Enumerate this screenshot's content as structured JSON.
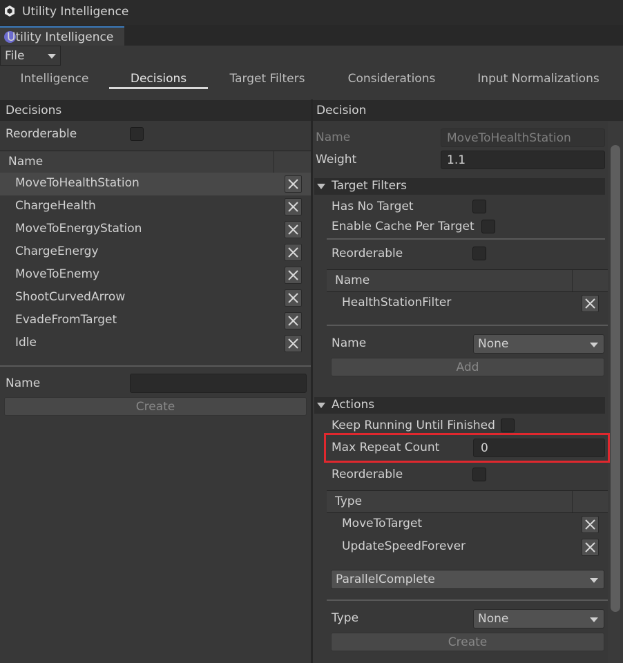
{
  "window": {
    "title": "Utility Intelligence",
    "tab_label": "Utility Intelligence"
  },
  "menu": {
    "file_label": "File"
  },
  "tabs": [
    {
      "label": "Intelligence"
    },
    {
      "label": "Decisions"
    },
    {
      "label": "Target Filters"
    },
    {
      "label": "Considerations"
    },
    {
      "label": "Input Normalizations"
    }
  ],
  "active_tab": "Decisions",
  "left_panel": {
    "header": "Decisions",
    "reorderable_label": "Reorderable",
    "column_name": "Name",
    "items": [
      {
        "label": "MoveToHealthStation"
      },
      {
        "label": "ChargeHealth"
      },
      {
        "label": "MoveToEnergyStation"
      },
      {
        "label": "ChargeEnergy"
      },
      {
        "label": "MoveToEnemy"
      },
      {
        "label": "ShootCurvedArrow"
      },
      {
        "label": "EvadeFromTarget"
      },
      {
        "label": "Idle"
      }
    ],
    "name_label": "Name",
    "name_value": "",
    "create_label": "Create"
  },
  "right_panel": {
    "header": "Decision",
    "name_label": "Name",
    "name_value": "MoveToHealthStation",
    "weight_label": "Weight",
    "weight_value": "1.1",
    "target_filters": {
      "title": "Target Filters",
      "has_no_target_label": "Has No Target",
      "enable_cache_label": "Enable Cache Per Target",
      "reorderable_label": "Reorderable",
      "column_name": "Name",
      "items": [
        {
          "label": "HealthStationFilter"
        }
      ],
      "name_label": "Name",
      "name_select": "None",
      "add_label": "Add"
    },
    "actions": {
      "title": "Actions",
      "keep_running_label": "Keep Running Until Finished",
      "max_repeat_label": "Max Repeat Count",
      "max_repeat_value": "0",
      "reorderable_label": "Reorderable",
      "column_type": "Type",
      "items": [
        {
          "label": "MoveToTarget"
        },
        {
          "label": "UpdateSpeedForever"
        }
      ],
      "mode_select": "ParallelComplete",
      "type_label": "Type",
      "type_select": "None",
      "create_label": "Create"
    }
  },
  "colors": {
    "highlight": "#e0282e",
    "underline": "#d9d9d9"
  }
}
